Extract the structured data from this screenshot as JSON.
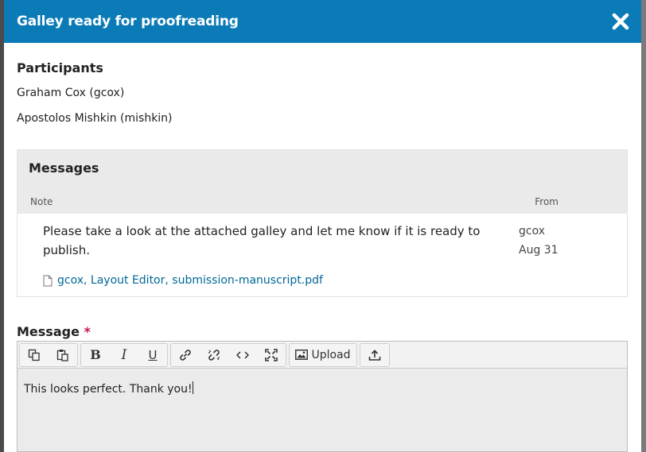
{
  "modal": {
    "title": "Galley ready for proofreading",
    "close_icon": "close-icon",
    "header_color": "#0b7bb8"
  },
  "participants": {
    "title": "Participants",
    "list": [
      "Graham Cox (gcox)",
      "Apostolos Mishkin (mishkin)"
    ]
  },
  "messages": {
    "title": "Messages",
    "columns": {
      "note": "Note",
      "from": "From"
    },
    "items": [
      {
        "text": "Please take a look at the attached galley and let me know if it is ready to publish.",
        "attachment": "gcox, Layout Editor, submission-manuscript.pdf",
        "from_user": "gcox",
        "from_date": "Aug 31"
      }
    ]
  },
  "message_field": {
    "label": "Message",
    "required_mark": "*",
    "value": "This looks perfect. Thank you!"
  },
  "toolbar": {
    "buttons": [
      "copy-icon",
      "paste-icon",
      "bold-icon",
      "italic-icon",
      "underline-icon",
      "link-icon",
      "unlink-icon",
      "code-icon",
      "fullscreen-icon",
      "image-icon",
      "upload-icon"
    ],
    "upload_label": "Upload"
  }
}
